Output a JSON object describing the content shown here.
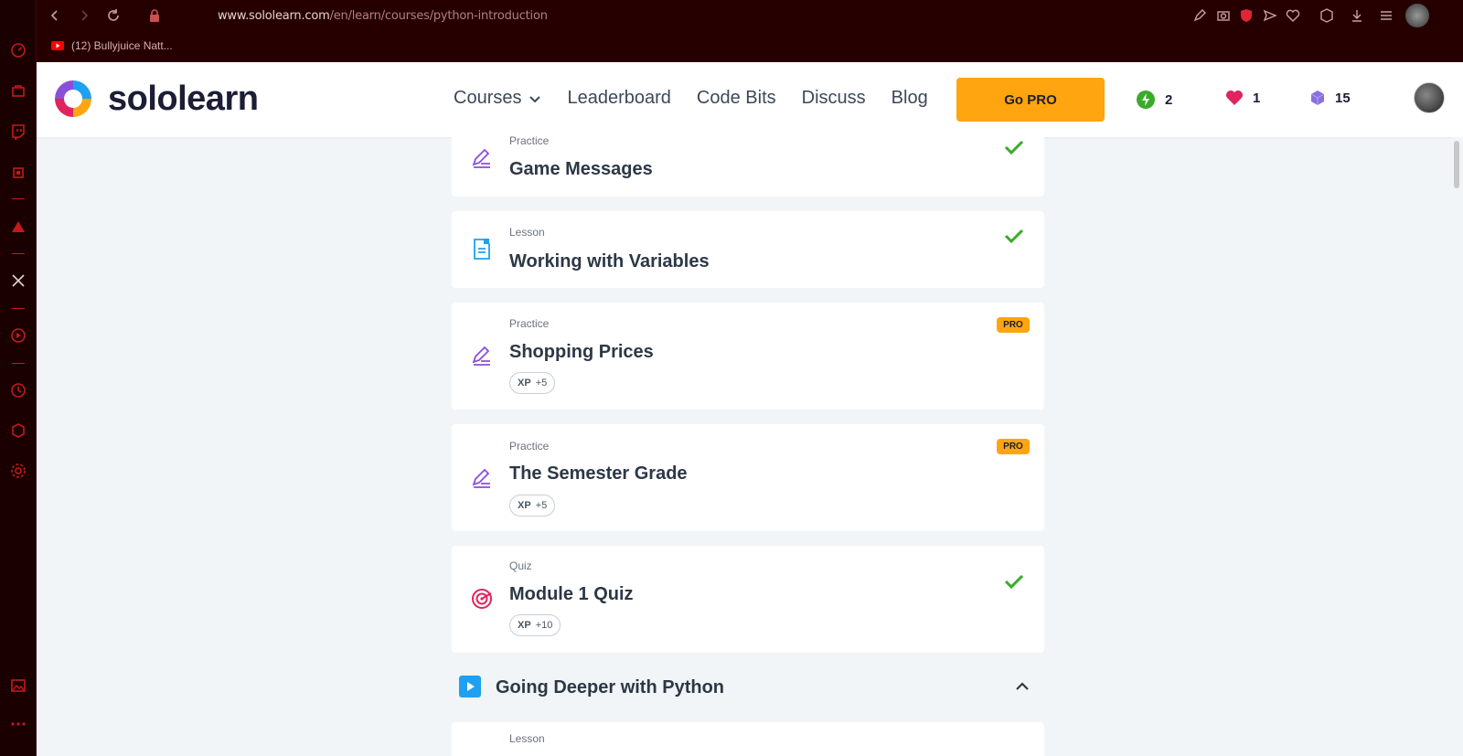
{
  "browser": {
    "url_domain": "www.sololearn.com",
    "url_path": "/en/learn/courses/python-introduction",
    "bookmark_label": "(12) Bullyjuice Natt..."
  },
  "nav": {
    "logo_text": "sololearn",
    "links": [
      "Courses",
      "Leaderboard",
      "Code Bits",
      "Discuss",
      "Blog"
    ],
    "go_pro": "Go PRO",
    "streak": "2",
    "hearts": "1",
    "bits": "15"
  },
  "lessons": [
    {
      "type": "Practice",
      "title": "Game Messages",
      "status": "completed",
      "icon": "pencil-icon"
    },
    {
      "type": "Lesson",
      "title": "Working with Variables",
      "status": "completed",
      "icon": "document-icon"
    },
    {
      "type": "Practice",
      "title": "Shopping Prices",
      "badge": "PRO",
      "xp_label": "XP",
      "xp_value": "+5",
      "icon": "pencil-icon"
    },
    {
      "type": "Practice",
      "title": "The Semester Grade",
      "badge": "PRO",
      "xp_label": "XP",
      "xp_value": "+5",
      "icon": "pencil-icon"
    },
    {
      "type": "Quiz",
      "title": "Module 1 Quiz",
      "status": "completed",
      "xp_label": "XP",
      "xp_value": "+10",
      "icon": "target-icon"
    }
  ],
  "section": {
    "title": "Going Deeper with Python",
    "next_type": "Lesson"
  },
  "colors": {
    "accent": "#ffa50f",
    "check": "#3aab2a",
    "practice": "#8a4fd9",
    "lesson": "#1fa0f0",
    "quiz": "#e0245e"
  }
}
